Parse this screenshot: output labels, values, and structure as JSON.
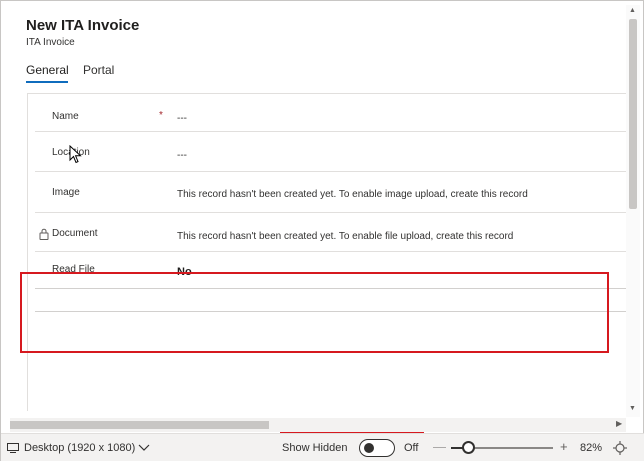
{
  "form": {
    "title": "New ITA Invoice",
    "subtitle": "ITA Invoice"
  },
  "tabs": [
    {
      "label": "General",
      "active": true
    },
    {
      "label": "Portal",
      "active": false
    }
  ],
  "fields": [
    {
      "label": "Name",
      "required": true,
      "value": "---"
    },
    {
      "label": "Location",
      "required": false,
      "value": "---"
    },
    {
      "label": "Image",
      "required": false,
      "value": "This record hasn't been created yet. To enable image upload, create this record"
    },
    {
      "label": "Document",
      "required": false,
      "locked": true,
      "value": "This record hasn't been created yet. To enable file upload, create this record"
    },
    {
      "label": "Read File",
      "required": false,
      "value": "No"
    }
  ],
  "required_marker": "*",
  "bottom_bar": {
    "device_label": "Desktop (1920 x 1080)",
    "show_hidden_label": "Show Hidden",
    "toggle_state": "Off",
    "toggle_on": false,
    "zoom_minus": "—",
    "zoom_plus": "+",
    "zoom_percent": "82%",
    "zoom_level": 0.18
  },
  "icons": {
    "device": "monitor-icon",
    "chevron": "chevron-down-icon",
    "lock": "lock-icon",
    "fit": "fit-to-screen-icon"
  },
  "colors": {
    "accent": "#0f6cbd",
    "highlight": "#d6191f",
    "required": "#a4262c"
  }
}
